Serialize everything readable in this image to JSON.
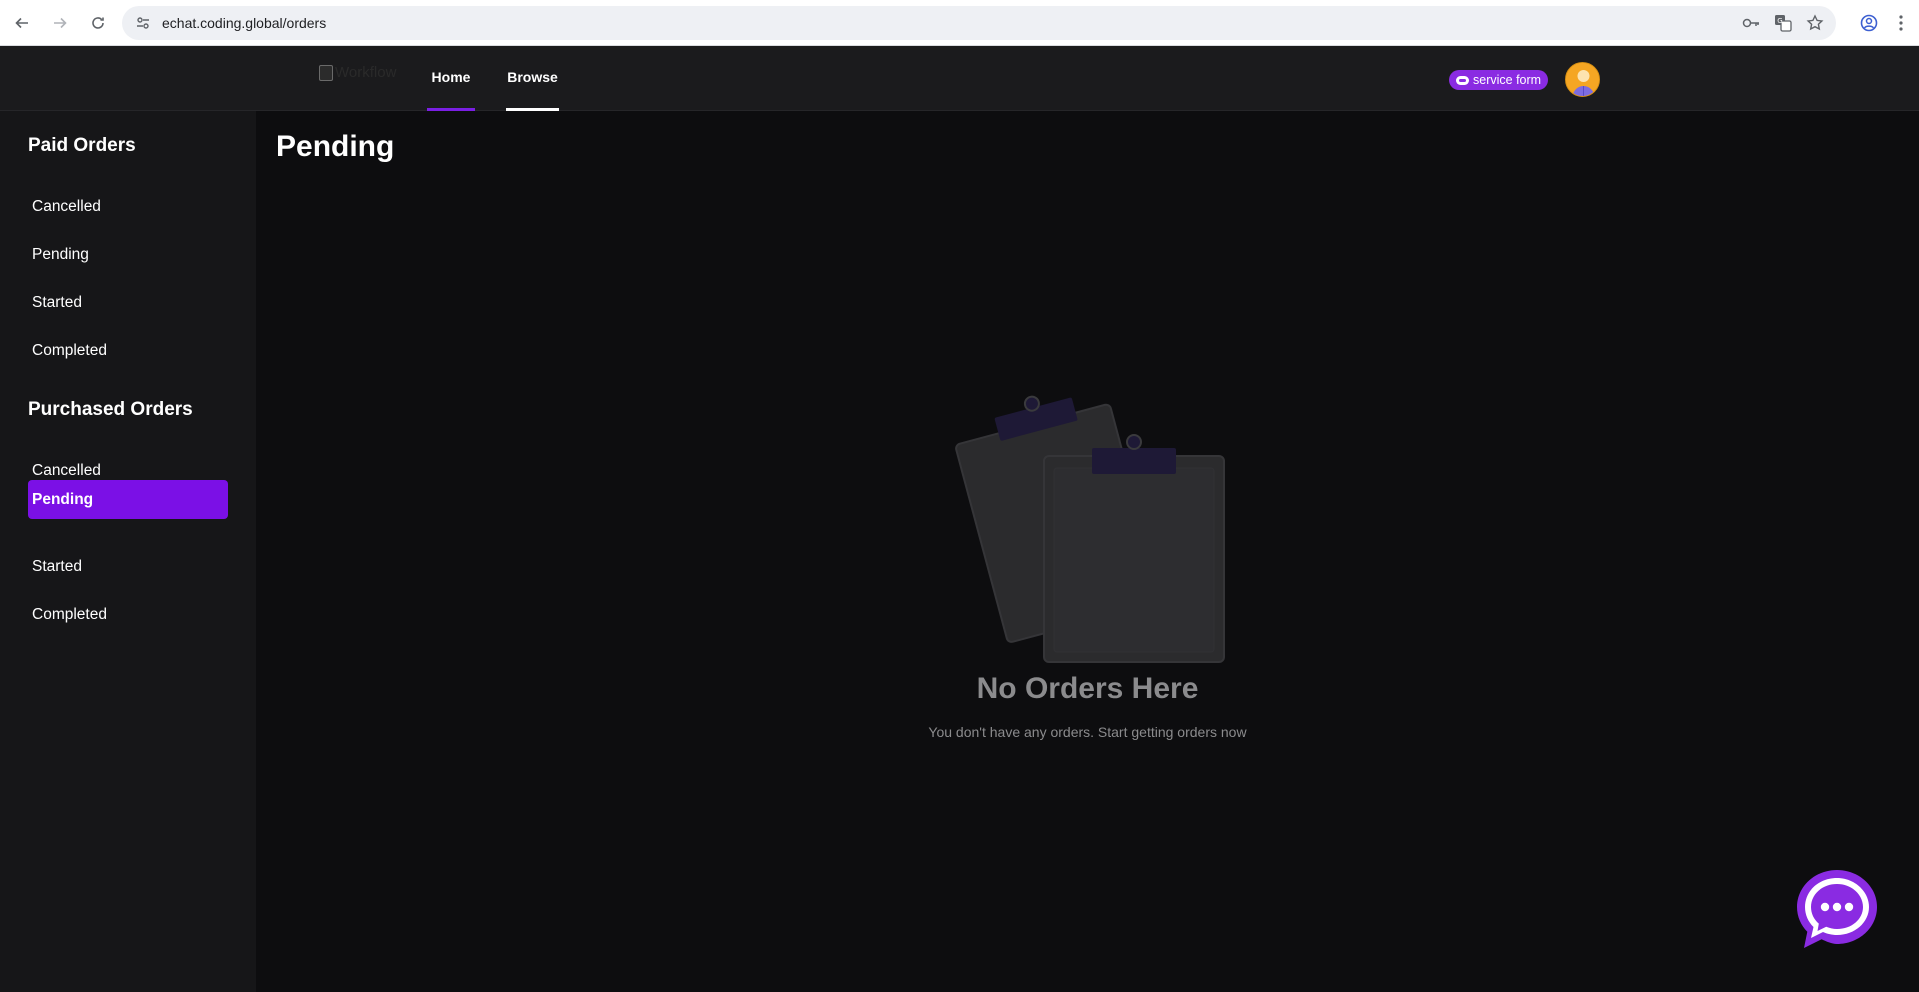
{
  "browser": {
    "url": "echat.coding.global/orders"
  },
  "header": {
    "logo_alt": "Workflow",
    "nav": [
      {
        "label": "Home"
      },
      {
        "label": "Browse"
      }
    ],
    "service_badge": "service form"
  },
  "sidebar": {
    "paid_title": "Paid Orders",
    "paid_items": [
      {
        "label": "Cancelled"
      },
      {
        "label": "Pending"
      },
      {
        "label": "Started"
      },
      {
        "label": "Completed"
      }
    ],
    "purchased_title": "Purchased Orders",
    "purchased_items": [
      {
        "label": "Cancelled"
      },
      {
        "label": "Pending",
        "active": true
      },
      {
        "label": "Started"
      },
      {
        "label": "Completed"
      }
    ]
  },
  "main": {
    "title": "Pending",
    "empty_title": "No Orders Here",
    "empty_subtitle": "You don't have any orders. Start getting orders now"
  },
  "colors": {
    "accent": "#7b10e6",
    "badge": "#8a2be2",
    "background": "#0d0d0f",
    "sidebar": "#161618",
    "header": "#1b1b1d"
  }
}
